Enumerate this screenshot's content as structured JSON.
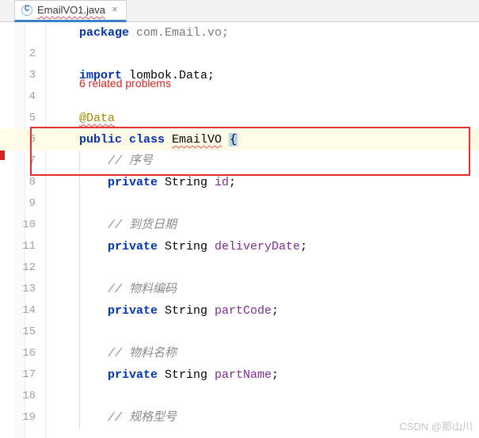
{
  "tab": {
    "label": "EmailVO1.java",
    "icon": "C"
  },
  "problems_hint": "6 related problems",
  "watermark": "CSDN @那山川",
  "gutter": [
    "",
    "2",
    "3",
    "4",
    "5",
    "6",
    "7",
    "8",
    "9",
    "10",
    "11",
    "12",
    "13",
    "14",
    "15",
    "16",
    "17",
    "18",
    "19"
  ],
  "code": {
    "line1_left": "package ",
    "line1_right": "com.Email.vo;",
    "import_kw": "import ",
    "import_pkg": "lombok.Data",
    "anno": "@Data",
    "public": "public ",
    "class": "class ",
    "classname": "EmailVO",
    "brace": "{",
    "c_seq": "// 序号",
    "private": "private ",
    "string": "String ",
    "id": "id",
    "c_delivery": "// 到货日期",
    "deliveryDate": "deliveryDate",
    "c_partcode": "// 物料编码",
    "partCode": "partCode",
    "c_partname": "// 物料名称",
    "partName": "partName",
    "c_spec": "// 规格型号",
    "semi": ";"
  }
}
